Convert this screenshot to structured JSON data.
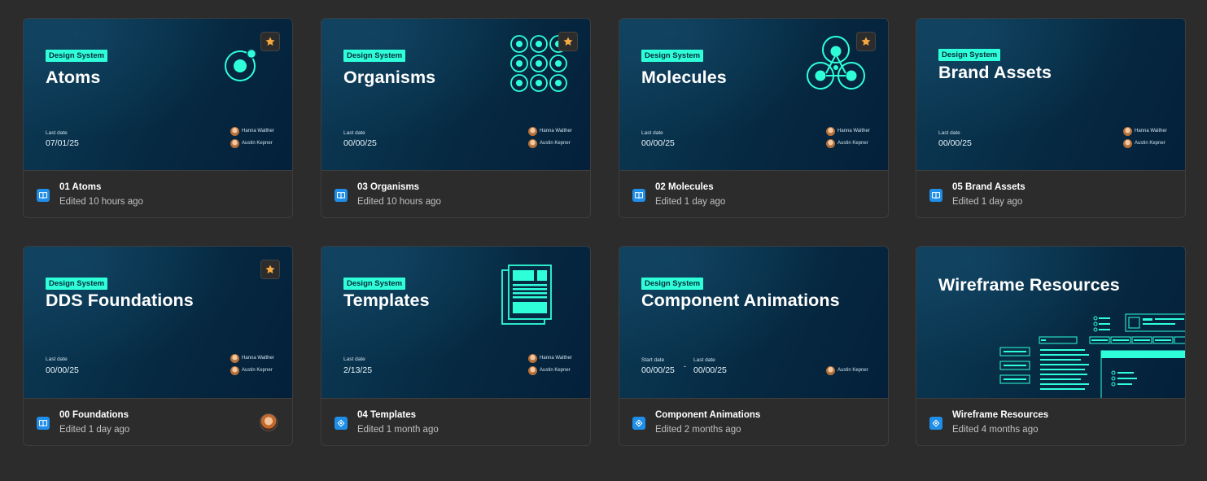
{
  "colors": {
    "accent": "#2fffd9",
    "star": "#f4a942",
    "file_icon": "#1e8ee8",
    "background": "#2c2c2c"
  },
  "files": [
    {
      "title": "Atoms",
      "tag": "Design System",
      "date_label": "Last date",
      "date": "07/01/25",
      "people": [
        "Hanna Walther",
        "Austin Kepner"
      ],
      "starred": true,
      "art": "atom-icon",
      "name": "01 Atoms",
      "edited": "Edited 10 hours ago",
      "file_icon": "book-icon"
    },
    {
      "title": "Organisms",
      "tag": "Design System",
      "date_label": "Last date",
      "date": "00/00/25",
      "people": [
        "Hanna Walther",
        "Austin Kepner"
      ],
      "starred": true,
      "art": "organism-grid-icon",
      "name": "03 Organisms",
      "edited": "Edited 10 hours ago",
      "file_icon": "book-icon"
    },
    {
      "title": "Molecules",
      "tag": "Design System",
      "date_label": "Last date",
      "date": "00/00/25",
      "people": [
        "Hanna Walther",
        "Austin Kepner"
      ],
      "starred": true,
      "art": "molecule-icon",
      "name": "02 Molecules",
      "edited": "Edited 1 day ago",
      "file_icon": "book-icon"
    },
    {
      "title": "Brand Assets",
      "tag": "Design System",
      "date_label": "Last date",
      "date": "00/00/25",
      "people": [
        "Hanna Walther",
        "Austin Kepner"
      ],
      "starred": false,
      "art": "",
      "name": "05 Brand Assets",
      "edited": "Edited 1 day ago",
      "file_icon": "book-icon"
    },
    {
      "title": "DDS Foundations",
      "tag": "Design System",
      "date_label": "Last date",
      "date": "00/00/25",
      "people": [
        "Hanna Walther",
        "Austin Kepner"
      ],
      "starred": true,
      "art": "",
      "name": "00 Foundations",
      "edited": "Edited 1 day ago",
      "file_icon": "book-icon",
      "owner_avatar": true
    },
    {
      "title": "Templates",
      "tag": "Design System",
      "date_label": "Last date",
      "date": "2/13/25",
      "people": [
        "Hanna Walther",
        "Austin Kepner"
      ],
      "starred": false,
      "art": "template-pages-icon",
      "name": "04 Templates",
      "edited": "Edited 1 month ago",
      "file_icon": "design-file-icon"
    },
    {
      "title": "Component Animations",
      "tag": "Design System",
      "start_label": "Start date",
      "start": "00/00/25",
      "separator": "-",
      "date_label": "Last date",
      "date": "00/00/25",
      "people": [
        "Austin Kepner"
      ],
      "starred": false,
      "art": "",
      "name": "Component Animations",
      "edited": "Edited 2 months ago",
      "file_icon": "design-file-icon"
    },
    {
      "title": "Wireframe Resources",
      "tag": "",
      "starred": false,
      "art": "wireframe-illustration",
      "name": "Wireframe Resources",
      "edited": "Edited 4 months ago",
      "file_icon": "design-file-icon"
    }
  ]
}
